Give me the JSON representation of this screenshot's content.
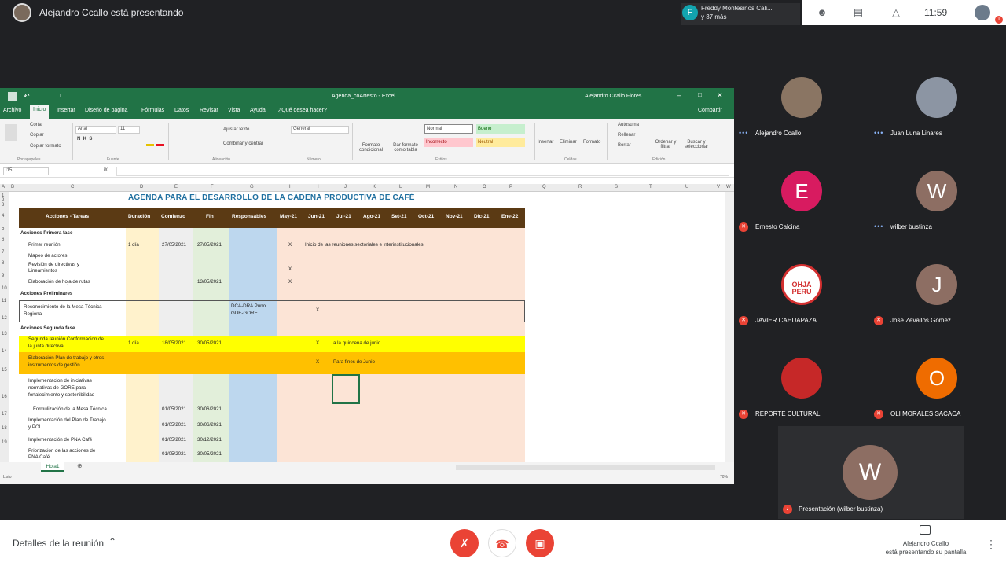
{
  "meeting": {
    "presenting_label": "Alejandro Ccallo está presentando",
    "joiner": {
      "initial": "F",
      "line1": "Freddy Montesinos Cali...",
      "line2": "y 37 más"
    },
    "clock": "11:59",
    "notif_count": "1",
    "details_label": "Detalles de la reunión",
    "present_status_line1": "Alejandro Ccallo",
    "present_status_line2": "está presentando su pantalla",
    "colors": {
      "red": "#ea4335",
      "dark": "#202124",
      "excel_green": "#217346"
    }
  },
  "excel": {
    "window_title": "Agenda_coArtesto - Excel",
    "user": "Alejandro Ccallo Flores",
    "share_label": "Compartir",
    "tabs": [
      "Archivo",
      "Inicio",
      "Insertar",
      "Diseño de página",
      "Fórmulas",
      "Datos",
      "Revisar",
      "Vista",
      "Ayuda",
      "¿Qué desea hacer?"
    ],
    "ribbon": {
      "cortar": "Cortar",
      "copiar": "Copiar",
      "copiar_formato": "Copiar formato",
      "font": "Arial",
      "size": "11",
      "ajustar": "Ajustar texto",
      "combinar": "Combinar y centrar",
      "general": "General",
      "formato_cond": "Formato condicional",
      "dar_formato": "Dar formato como tabla",
      "normal": "Normal",
      "bueno": "Bueno",
      "incorrecto": "Incorrecto",
      "neutral": "Neutral",
      "insertar": "Insertar",
      "eliminar": "Eliminar",
      "formato": "Formato",
      "autosuma": "Autosuma",
      "rellenar": "Rellenar",
      "borrar": "Borrar",
      "ordenar": "Ordenar y filtrar",
      "buscar": "Buscar y seleccionar",
      "groups": [
        "Portapapeles",
        "Fuente",
        "Alineación",
        "Número",
        "Estilos",
        "Celdas",
        "Edición"
      ]
    },
    "name_box": "I15",
    "columns": [
      "A",
      "B",
      "C",
      "D",
      "E",
      "F",
      "G",
      "H",
      "I",
      "J",
      "K",
      "L",
      "M",
      "N",
      "O",
      "P",
      "Q",
      "R",
      "S",
      "T",
      "U",
      "V",
      "W"
    ],
    "rows": [
      "1",
      "2",
      "3",
      "4",
      "5",
      "6",
      "7",
      "8",
      "9",
      "10",
      "11",
      "12",
      "13",
      "14",
      "15",
      "16",
      "17",
      "18",
      "19"
    ],
    "sheet_title": "AGENDA PARA EL DESARROLLO DE LA CADENA PRODUCTIVA DE CAFÉ",
    "headers": [
      "Acciones - Tareas",
      "Duración",
      "Comienzo",
      "Fin",
      "Responsables",
      "May-21",
      "Jun-21",
      "Jul-21",
      "Ago-21",
      "Set-21",
      "Oct-21",
      "Nov-21",
      "Dic-21",
      "Ene-22"
    ],
    "cells": {
      "s1": "Acciones Primera fase",
      "r1_task": "Primer reunión",
      "r1_dur": "1 día",
      "r1_start": "27/05/2021",
      "r1_end": "27/05/2021",
      "r1_x": "X",
      "r1_note": "Inicio de las reuniones sectoriales e interinstitucionales",
      "r2_task": "Mapeo de actores",
      "r3_task1": "Revisión de directivas y",
      "r3_task2": "Lineamientos",
      "r3_x": "X",
      "r4_task": "Elaboración de hoja de rutas",
      "r4_end": "13/05/2021",
      "r4_x": "X",
      "s2": "Acciones Preliminares",
      "r5_task1": "Reconocimiento de la Mesa Técnica",
      "r5_task2": "Regional",
      "r5_resp1": "DCA-DRA Puno",
      "r5_resp2": "GDE-GORE",
      "r5_x": "X",
      "s3": "Acciones Segunda fase",
      "r6_task1": "Segunda reunión Conformacion de",
      "r6_task2": "la junta directiva",
      "r6_dur": "1 día",
      "r6_start": "18/05/2021",
      "r6_end": "30/05/2021",
      "r6_x": "X",
      "r6_note": "a la quincena de junio",
      "r7_task1": "Elaboración Plan de trabajo y otros",
      "r7_task2": "instrumentos de gestión",
      "r7_x": "X",
      "r7_note": "Para fines de Junio",
      "r8_task1": "Implementacion de iniciativas",
      "r8_task2": "normativas de GORE para",
      "r8_task3": "fortalecimiento y sostenibilidad",
      "r9_task": "Formulización de la Mesa Técnica",
      "r9_start": "01/05/2021",
      "r9_end": "30/06/2021",
      "r10_task1": "Implementación del Plan de Trabajo",
      "r10_task2": "y POI",
      "r10_start": "01/05/2021",
      "r10_end": "30/06/2021",
      "r11_task": "Implementación de PNA Café",
      "r11_start": "01/05/2021",
      "r11_end": "30/12/2021",
      "r12_task1": "Priorización de las acciones de",
      "r12_task2": "PNA Café",
      "r12_start": "01/05/2021",
      "r12_end": "30/05/2021"
    },
    "sheet_tab": "Hoja1",
    "status": "Listo",
    "zoom": "70%"
  },
  "participants": [
    {
      "name": "Alejandro Ccallo",
      "initial": "",
      "color": "#8a7563",
      "status": "dots"
    },
    {
      "name": "Juan Luna Linares",
      "initial": "",
      "color": "#8c95a3",
      "status": "dots"
    },
    {
      "name": "Ernesto Calcina",
      "initial": "E",
      "color": "#d81b60",
      "status": "mic-off"
    },
    {
      "name": "wilber bustinza",
      "initial": "W",
      "color": "#8d6e63",
      "status": "dots"
    },
    {
      "name": "JAVIER CAHUAPAZA",
      "initial": "",
      "color": "#d32f2f",
      "status": "mic-off",
      "logo": "OHJA PERU"
    },
    {
      "name": "Jose Zevallos Gomez",
      "initial": "J",
      "color": "#8d6e63",
      "status": "mic-off"
    },
    {
      "name": "REPORTE CULTURAL",
      "initial": "",
      "color": "#c62828",
      "status": "mic-off"
    },
    {
      "name": "OLI MORALES SACACA",
      "initial": "O",
      "color": "#ef6c00",
      "status": "mic-off"
    }
  ],
  "presentation_tile": {
    "initial": "W",
    "color": "#8d6e63",
    "name": "Presentación (wilber bustinza)"
  }
}
